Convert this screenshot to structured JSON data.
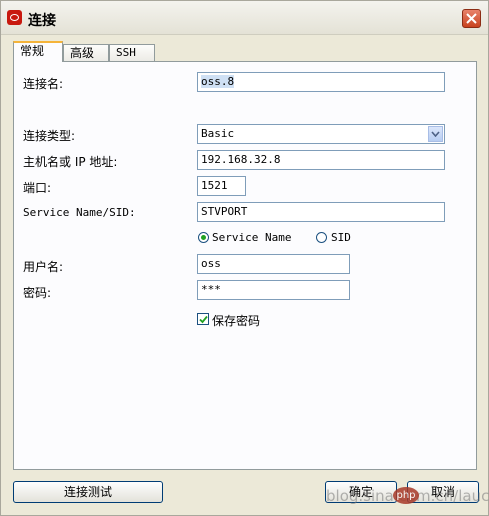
{
  "window": {
    "title": "连接"
  },
  "tabs": [
    "常规",
    "高级",
    "SSH"
  ],
  "form": {
    "connection_name_label": "连接名:",
    "connection_name_value": "oss.8",
    "connection_type_label": "连接类型:",
    "connection_type_value": "Basic",
    "host_label": "主机名或 IP 地址:",
    "host_value": "192.168.32.8",
    "port_label": "端口:",
    "port_value": "1521",
    "service_label": "Service Name/SID:",
    "service_value": "STVPORT",
    "radio_service_name": "Service Name",
    "radio_sid": "SID",
    "username_label": "用户名:",
    "username_value": "oss",
    "password_label": "密码:",
    "password_value": "***",
    "save_password_label": "保存密码",
    "save_password_checked": true
  },
  "buttons": {
    "test": "连接测试",
    "ok": "确定",
    "cancel": "取消"
  },
  "watermark": {
    "text": "blog.sina.com.cn/laucer",
    "logo": "php"
  }
}
